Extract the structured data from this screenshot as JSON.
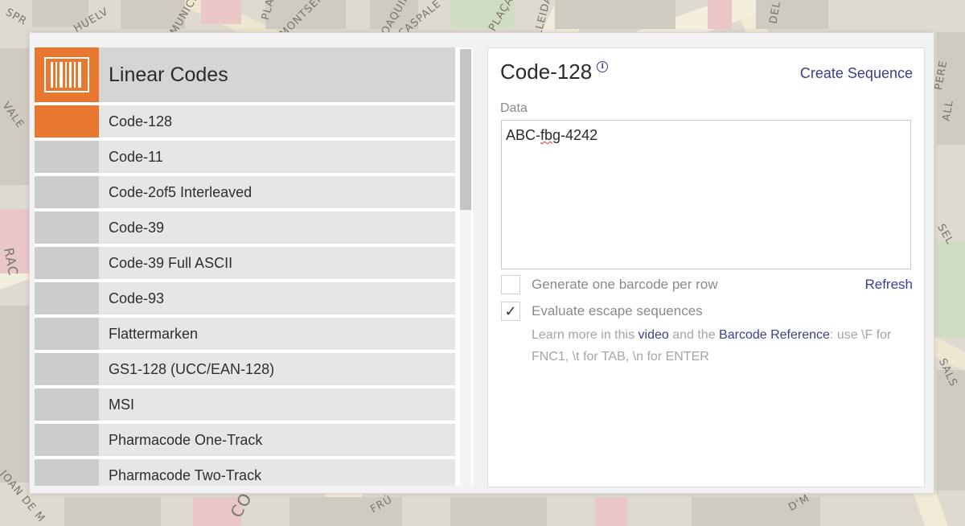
{
  "map": {
    "streets": [
      "SPR",
      "HUELV",
      "MUNICIP",
      "PLA",
      "MONTSER",
      "JOAQUIN",
      "CASPALE",
      "PLAÇA",
      "LLEIDA",
      "DEL",
      "PERE",
      "ALL",
      "VALE",
      "RAC",
      "SEL",
      "SALS",
      "JOAN DE M",
      "FRÚ",
      "CO",
      "D'M"
    ]
  },
  "category": {
    "title": "Linear Codes",
    "icon": "barcode-icon"
  },
  "symbologies": [
    {
      "label": "Code-128",
      "active": true
    },
    {
      "label": "Code-11",
      "active": false
    },
    {
      "label": "Code-2of5 Interleaved",
      "active": false
    },
    {
      "label": "Code-39",
      "active": false
    },
    {
      "label": "Code-39 Full ASCII",
      "active": false
    },
    {
      "label": "Code-93",
      "active": false
    },
    {
      "label": "Flattermarken",
      "active": false
    },
    {
      "label": "GS1-128 (UCC/EAN-128)",
      "active": false
    },
    {
      "label": "MSI",
      "active": false
    },
    {
      "label": "Pharmacode One-Track",
      "active": false
    },
    {
      "label": "Pharmacode Two-Track",
      "active": false
    }
  ],
  "panel": {
    "title": "Code-128",
    "info_icon": "info-icon",
    "create_sequence": "Create Sequence",
    "data_label": "Data",
    "data_value_pre": "ABC-",
    "data_value_marked": "fbg",
    "data_value_post": "-4242",
    "option_per_row": "Generate one barcode per row",
    "option_per_row_checked": false,
    "option_escape": "Evaluate escape sequences",
    "option_escape_checked": true,
    "check_glyph": "✓",
    "refresh": "Refresh",
    "help_pre": "Learn more in this ",
    "help_video": "video",
    "help_mid": " and the ",
    "help_reference": "Barcode Reference",
    "help_post": ": use \\F for FNC1, \\t for TAB, \\n for ENTER"
  },
  "colors": {
    "accent": "#e87730",
    "link": "#3d3d8e"
  }
}
